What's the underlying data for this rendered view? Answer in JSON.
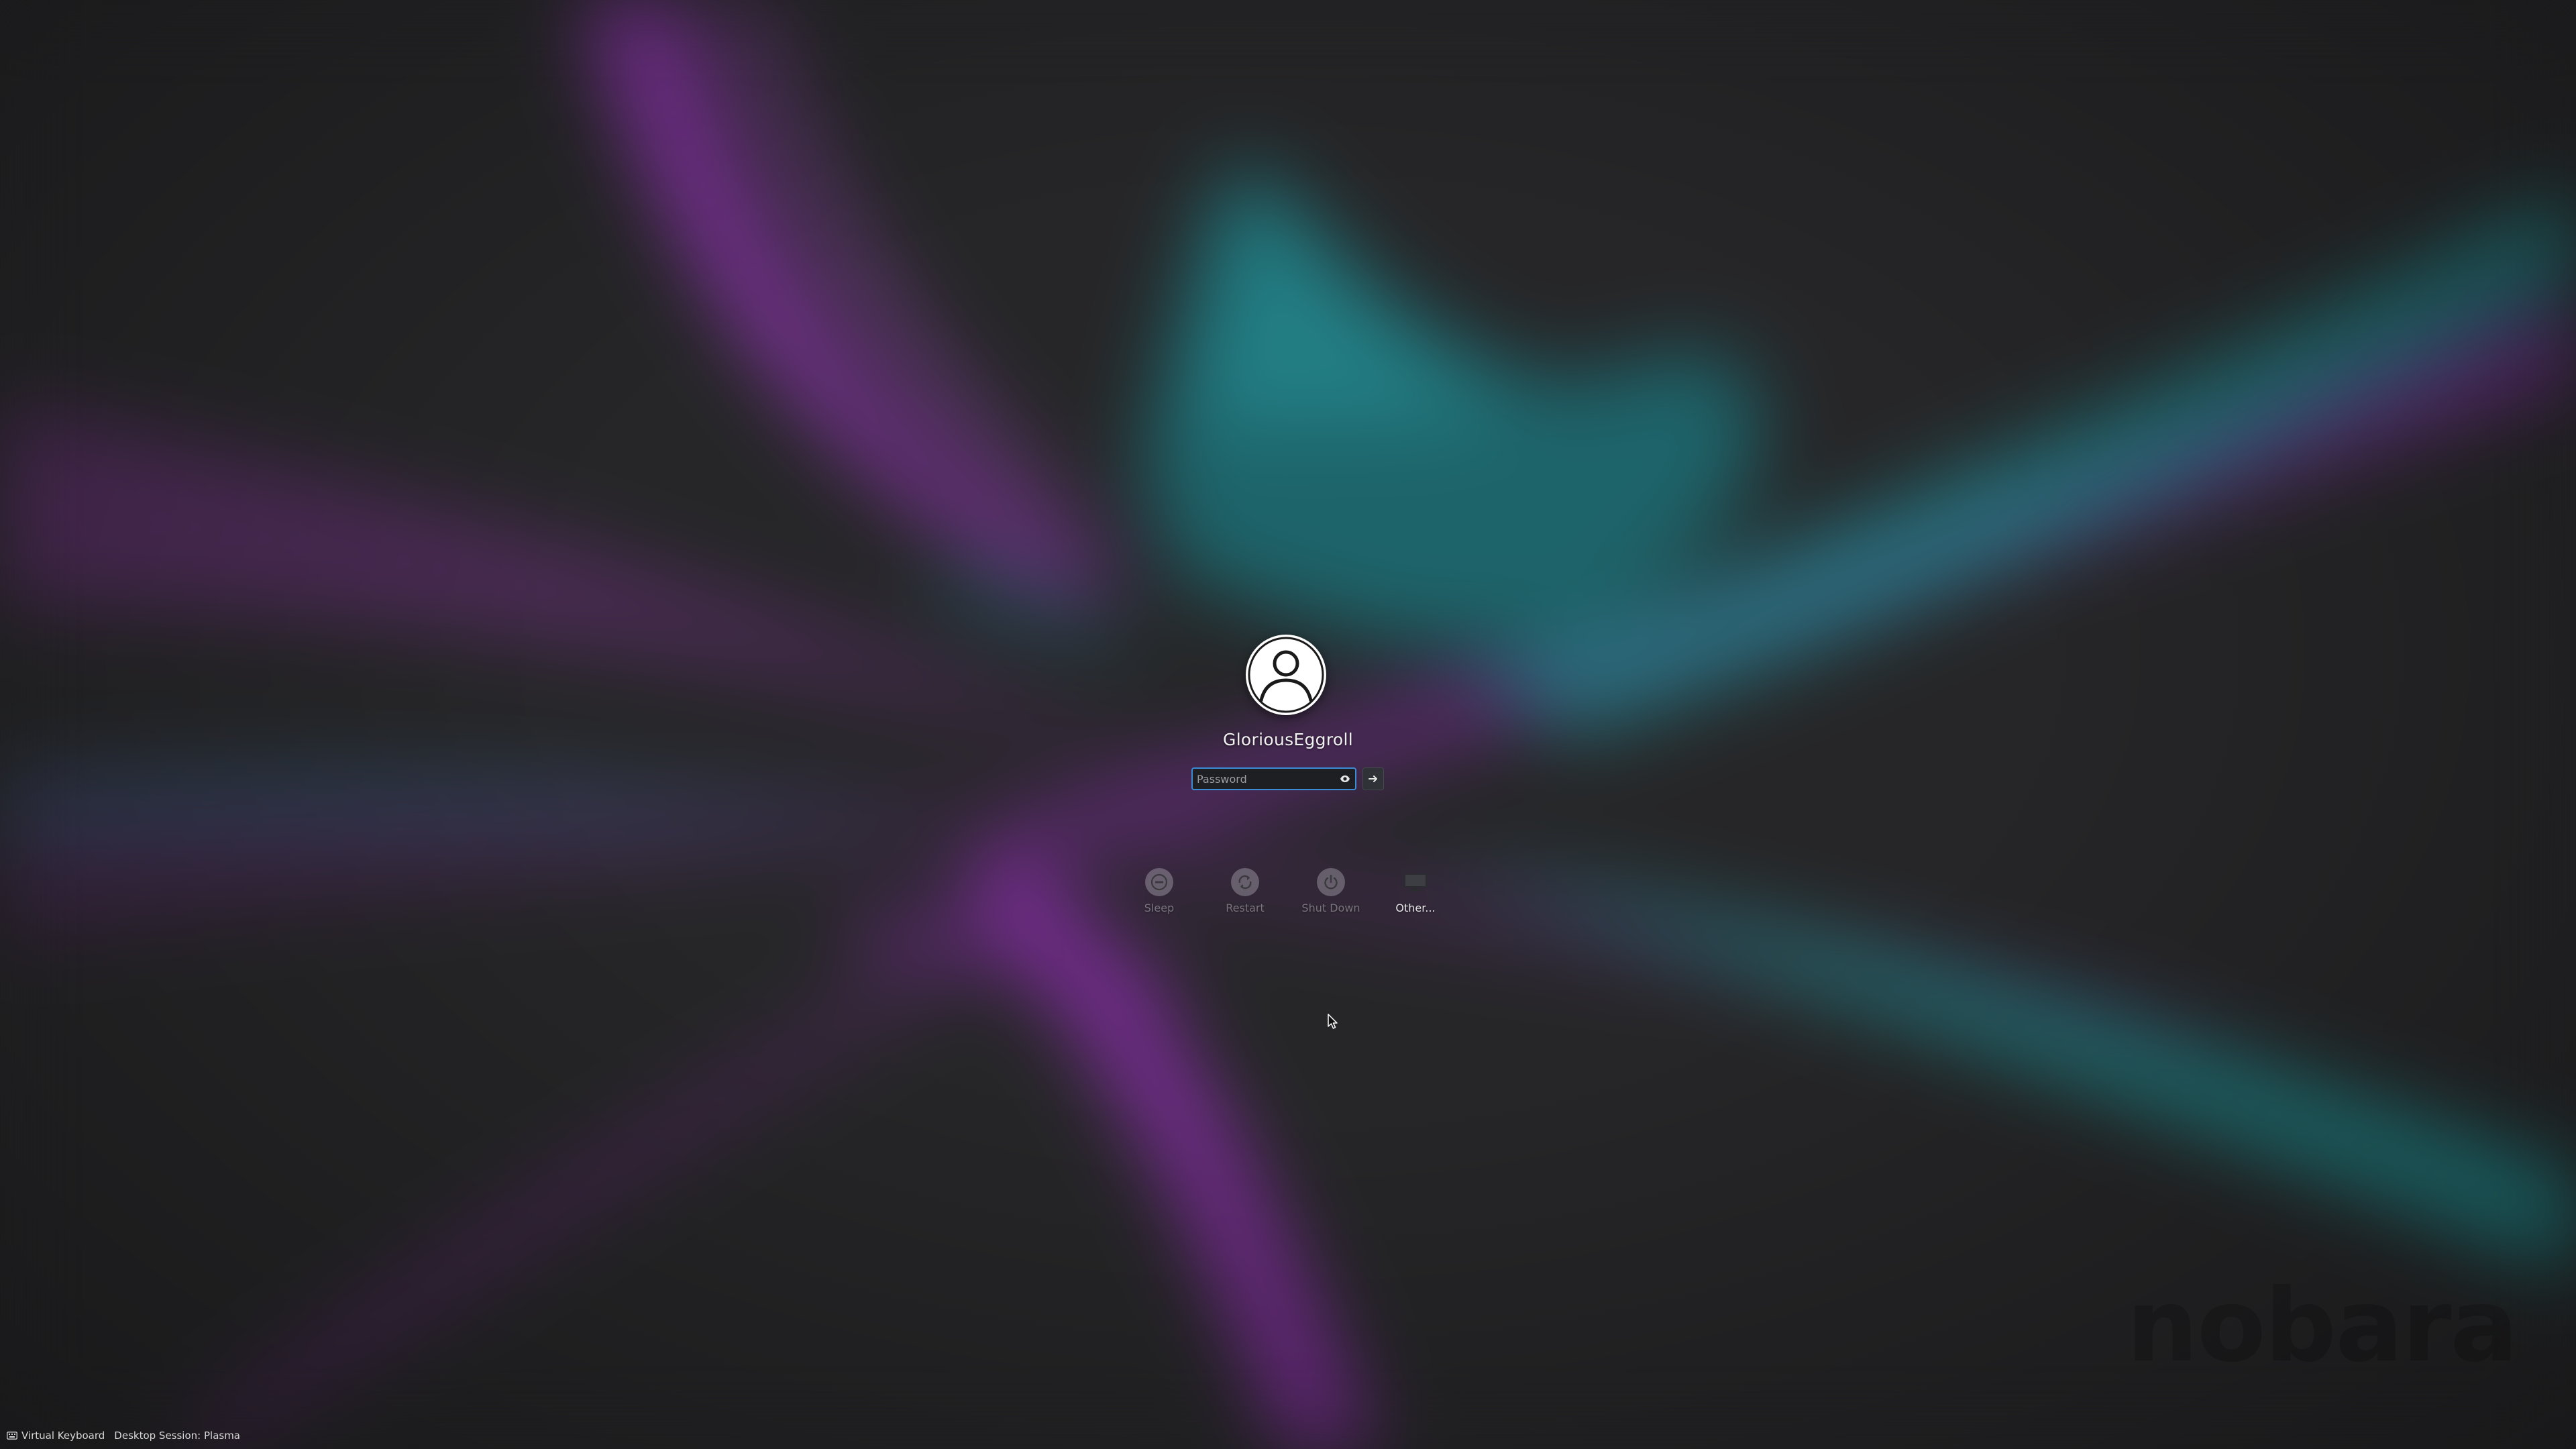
{
  "theme": {
    "background": "#262628",
    "purple": "#8a2fa8",
    "teal": "#1f8a8c",
    "accent": "#3b8bd6"
  },
  "login": {
    "avatar_icon": "user-icon",
    "username": "GloriousEggroll",
    "password_placeholder": "Password",
    "password_value": "",
    "reveal_icon": "eye-icon",
    "submit_icon": "arrow-right-icon"
  },
  "actions": [
    {
      "label": "Sleep",
      "icon": "sleep-icon",
      "active": false
    },
    {
      "label": "Restart",
      "icon": "restart-icon",
      "active": false
    },
    {
      "label": "Shut Down",
      "icon": "power-icon",
      "active": false
    },
    {
      "label": "Other...",
      "icon": "monitor-icon",
      "active": true
    }
  ],
  "bottom_bar": {
    "virtual_keyboard_label": "Virtual Keyboard",
    "virtual_keyboard_icon": "keyboard-icon",
    "session_label": "Desktop Session: Plasma"
  },
  "watermark": "nobara"
}
